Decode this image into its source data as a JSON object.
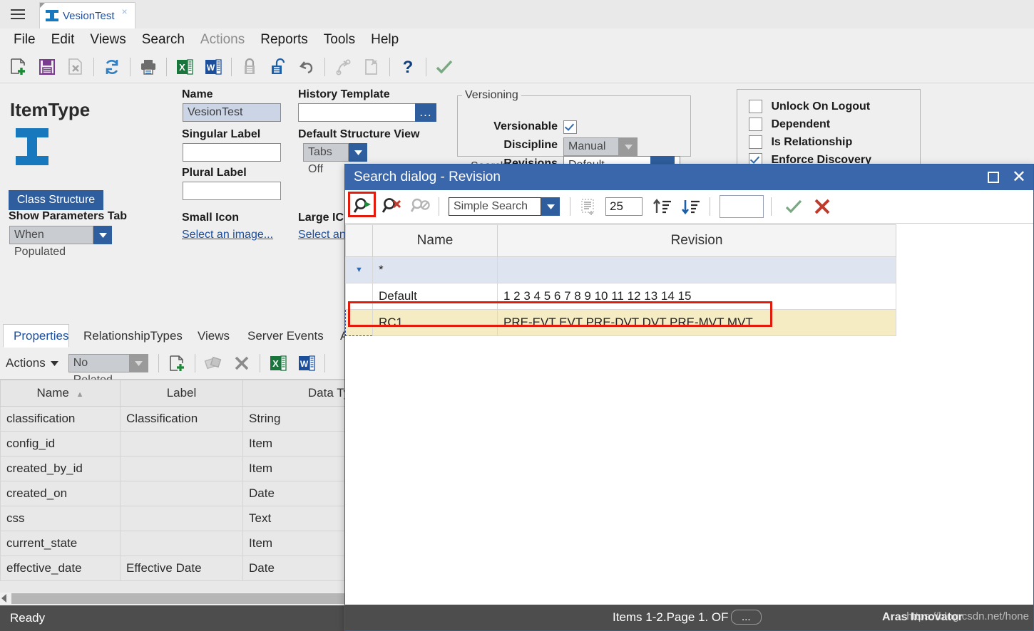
{
  "window": {
    "tab_title": "VesionTest",
    "tab_close": "×"
  },
  "menu": {
    "items": [
      {
        "label": "File",
        "dim": false
      },
      {
        "label": "Edit",
        "dim": false
      },
      {
        "label": "Views",
        "dim": false
      },
      {
        "label": "Search",
        "dim": false
      },
      {
        "label": "Actions",
        "dim": true
      },
      {
        "label": "Reports",
        "dim": false
      },
      {
        "label": "Tools",
        "dim": false
      },
      {
        "label": "Help",
        "dim": false
      }
    ]
  },
  "toolbar": {
    "icons": [
      "new-item-icon",
      "save-icon",
      "delete-item-icon",
      "refresh-icon",
      "print-icon",
      "export-excel-icon",
      "export-word-icon",
      "lock-icon",
      "unlock-icon",
      "undo-icon",
      "promote-icon",
      "copy-icon",
      "help-icon",
      "done-icon"
    ]
  },
  "form": {
    "title": "ItemType",
    "item_icon": "itemtype-icon",
    "class_structure_button": "Class Structure",
    "show_parameters_tab_label": "Show Parameters Tab",
    "show_parameters_tab_value": "When Populated",
    "name_label": "Name",
    "name_value": "VesionTest",
    "singular_label_label": "Singular Label",
    "singular_label_value": "",
    "plural_label_label": "Plural Label",
    "plural_label_value": "",
    "small_icon_label": "Small Icon",
    "small_icon_link": "Select an image...",
    "history_template_label": "History Template",
    "history_template_value": "",
    "history_template_ellipsis": "...",
    "default_structure_view_label": "Default Structure View",
    "default_structure_view_value": "Tabs Off",
    "large_icon_label": "Large IC",
    "large_icon_link": "Select an",
    "versioning": {
      "legend": "Versioning",
      "versionable_label": "Versionable",
      "versionable_checked": true,
      "discipline_label": "Discipline",
      "discipline_value": "Manual",
      "revisions_label": "Revisions",
      "revisions_value": "Default",
      "revisions_ellipsis": "..."
    },
    "search_legend": "Search",
    "flags": [
      {
        "label": "Unlock On Logout",
        "checked": false
      },
      {
        "label": "Dependent",
        "checked": false
      },
      {
        "label": "Is Relationship",
        "checked": false
      },
      {
        "label": "Enforce Discovery",
        "checked": true
      }
    ]
  },
  "bottom_tabs": [
    {
      "label": "Properties",
      "active": true
    },
    {
      "label": "RelationshipTypes",
      "active": false
    },
    {
      "label": "Views",
      "active": false
    },
    {
      "label": "Server Events",
      "active": false
    },
    {
      "label": "A",
      "active": false
    }
  ],
  "props_toolbar": {
    "actions_label": "Actions",
    "related_value": "No Related",
    "icons": [
      "add-property-icon",
      "copy-paste-icon",
      "delete-icon",
      "export-excel-icon",
      "export-word-icon"
    ]
  },
  "props_grid": {
    "columns": [
      "Name",
      "Label",
      "Data Type"
    ],
    "sort_column": "Name",
    "sort_direction": "asc",
    "rows": [
      {
        "name": "classification",
        "label": "Classification",
        "data_type": "String"
      },
      {
        "name": "config_id",
        "label": "",
        "data_type": "Item"
      },
      {
        "name": "created_by_id",
        "label": "",
        "data_type": "Item"
      },
      {
        "name": "created_on",
        "label": "",
        "data_type": "Date"
      },
      {
        "name": "css",
        "label": "",
        "data_type": "Text"
      },
      {
        "name": "current_state",
        "label": "",
        "data_type": "Item"
      },
      {
        "name": "effective_date",
        "label": "Effective Date",
        "data_type": "Date"
      }
    ]
  },
  "status": {
    "ready": "Ready"
  },
  "dialog": {
    "title": "Search dialog - Revision",
    "maximize_icon": "maximize-icon",
    "close_icon": "close-icon",
    "toolbar": {
      "run_search_label": "run-search-icon",
      "clear_search_label": "clear-search-icon",
      "disable-search_label": "disable-search-icon",
      "mode_value": "Simple Search",
      "list_icon": "new-query-icon",
      "page_size": "25",
      "sort_asc_icon": "sort-ascending-icon",
      "sort_desc_icon": "sort-descending-icon",
      "text_value": "",
      "ok_icon": "confirm-icon",
      "cancel_icon": "cancel-icon"
    },
    "grid": {
      "columns": [
        "Name",
        "Revision"
      ],
      "filter_row": {
        "name": "*",
        "revision": ""
      },
      "rows": [
        {
          "name": "Default",
          "revision": "1 2 3 4 5 6 7 8 9 10 11 12 13 14 15",
          "selected": false
        },
        {
          "name": "RC1",
          "revision": "PRE-EVT EVT PRE-DVT DVT PRE-MVT MVT",
          "selected": true
        }
      ]
    },
    "status": {
      "items_text": "Items 1-2.Page 1. OF",
      "page_button": "...",
      "watermark_a": "https://blog.csdn.net/hone",
      "watermark_b": "Aras Innovator"
    }
  },
  "colors": {
    "accent_blue": "#2f5e9e",
    "dialog_titlebar": "#3a66ab",
    "highlight_row": "#f5ecc4",
    "filter_row": "#dfe5f0",
    "red_annotation": "#e21b0c",
    "status_bar": "#4d4d4d"
  }
}
